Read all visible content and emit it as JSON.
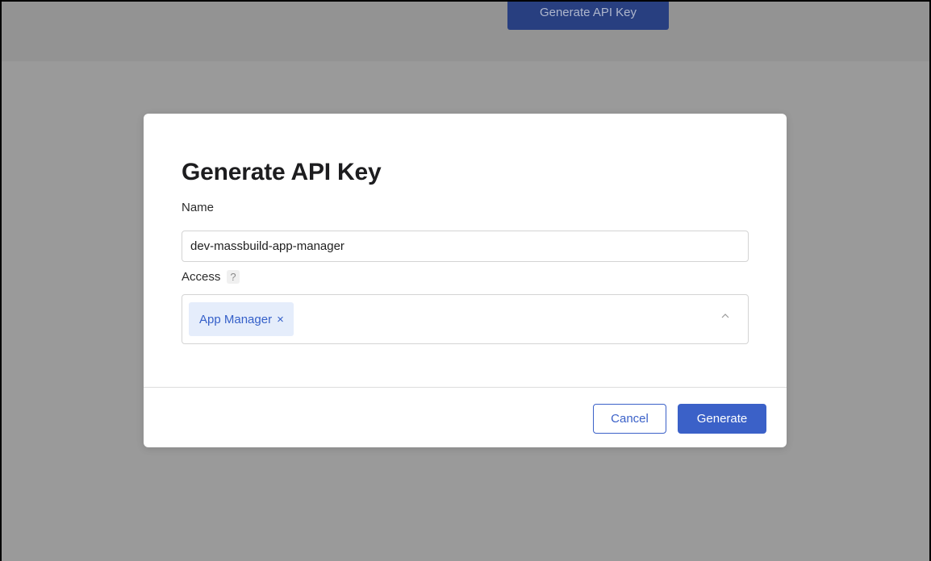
{
  "background": {
    "header_button_label": "Generate API Key"
  },
  "modal": {
    "title": "Generate API Key",
    "name_field": {
      "label": "Name",
      "value": "dev-massbuild-app-manager",
      "placeholder": ""
    },
    "access_field": {
      "label": "Access",
      "help_icon_glyph": "?",
      "selected_tags": [
        {
          "label": "App Manager",
          "remove_glyph": "×"
        }
      ]
    },
    "footer": {
      "cancel_label": "Cancel",
      "generate_label": "Generate"
    }
  },
  "icons": {
    "help": "question-icon",
    "tag_remove": "close-icon",
    "dropdown": "chevron-up-icon"
  },
  "colors": {
    "accent": "#3b61c8",
    "tag_background": "#e5edfb",
    "overlay": "#9a9a9a"
  }
}
